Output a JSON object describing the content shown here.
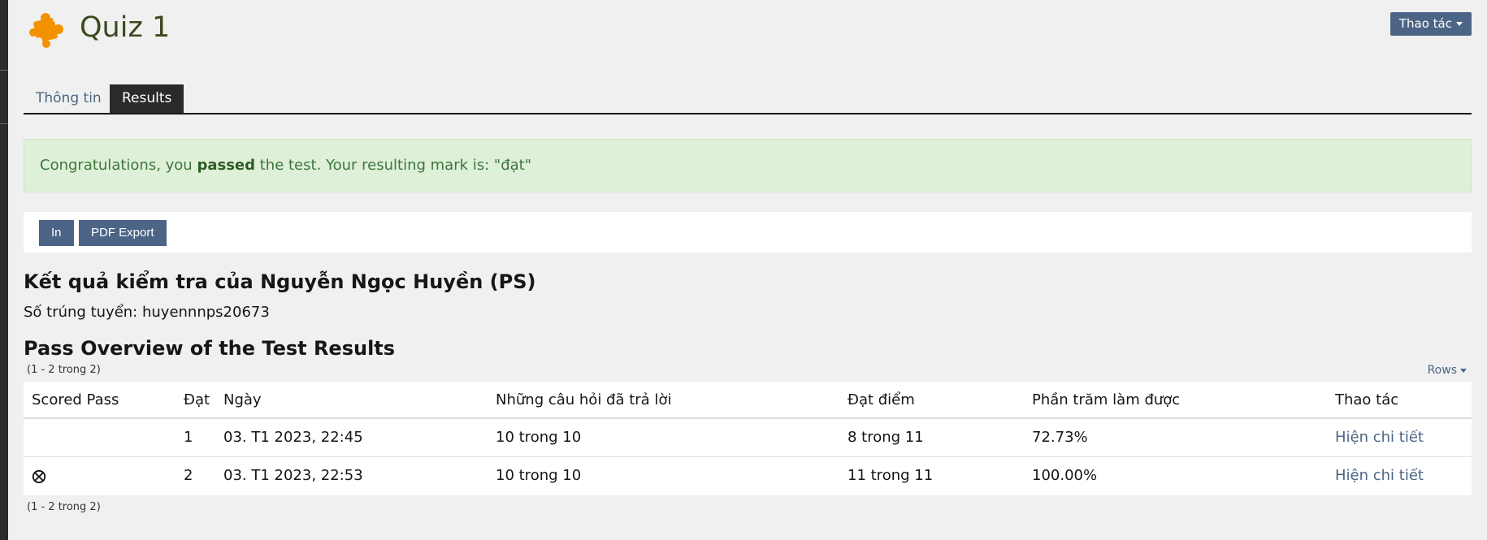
{
  "header": {
    "title": "Quiz 1",
    "actions_label": "Thao tác"
  },
  "tabs": [
    {
      "label": "Thông tin",
      "active": false
    },
    {
      "label": "Results",
      "active": true
    }
  ],
  "alert": {
    "prefix": "Congratulations, you ",
    "strong": "passed",
    "suffix": " the test. Your resulting mark is: \"đạt\""
  },
  "toolbar": {
    "print_label": "In",
    "pdf_label": "PDF Export"
  },
  "result": {
    "heading": "Kết quả kiểm tra của Nguyễn Ngọc Huyền (PS)",
    "registration": "Số trúng tuyển: huyennnps20673"
  },
  "overview": {
    "heading": "Pass Overview of the Test Results",
    "pager": "(1 - 2 trong 2)",
    "rows_label": "Rows",
    "columns": [
      "Scored Pass",
      "Đạt",
      "Ngày",
      "Những câu hỏi đã trả lời",
      "Đạt điểm",
      "Phần trăm làm được",
      "Thao tác"
    ],
    "rows": [
      {
        "scored_pass": "",
        "pass": "1",
        "date": "03. T1 2023, 22:45",
        "answered": "10 trong 10",
        "points": "8 trong 11",
        "percent": "72.73%",
        "action": "Hiện chi tiết"
      },
      {
        "scored_pass": "scored-pass-icon",
        "pass": "2",
        "date": "03. T1 2023, 22:53",
        "answered": "10 trong 10",
        "points": "11 trong 11",
        "percent": "100.00%",
        "action": "Hiện chi tiết"
      }
    ],
    "pager_bottom": "(1 - 2 trong 2)"
  },
  "colors": {
    "accent": "#4c6586",
    "alert_bg": "#dff0d8",
    "alert_text": "#3c763d",
    "icon_orange": "#f39200"
  }
}
